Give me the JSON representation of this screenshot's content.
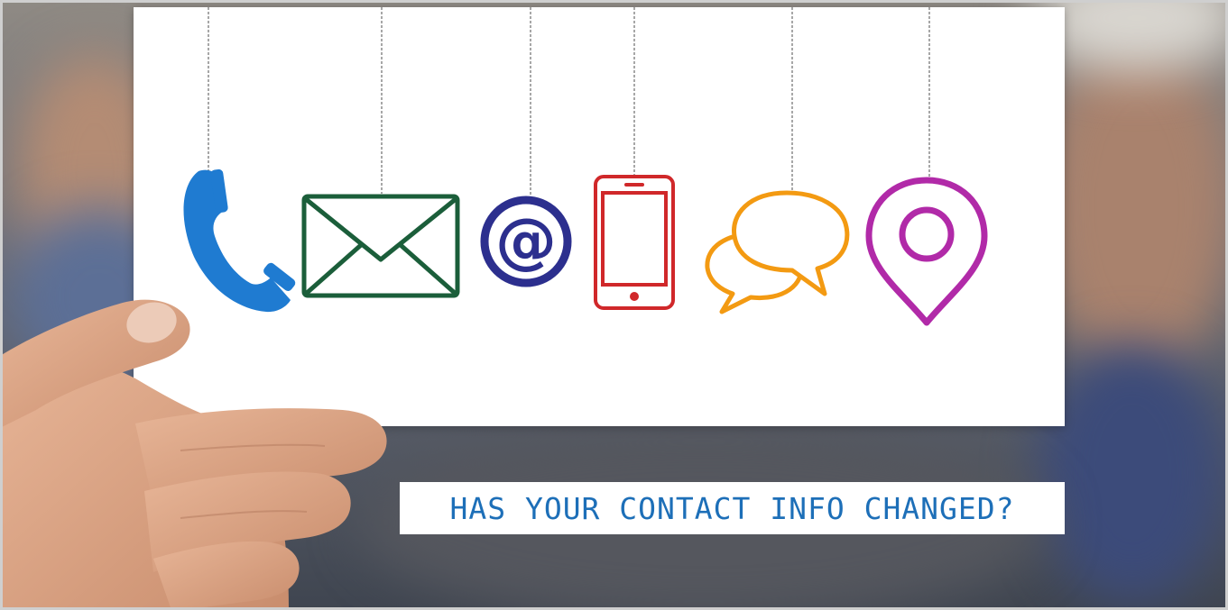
{
  "caption": {
    "text": "HAS YOUR CONTACT INFO CHANGED?",
    "color": "#1d6fb8"
  },
  "icons": [
    {
      "name": "phone-icon",
      "color": "#1f7bd1"
    },
    {
      "name": "envelope-icon",
      "color": "#1b5e3a"
    },
    {
      "name": "at-sign-icon",
      "color": "#2c2f8e"
    },
    {
      "name": "mobile-phone-icon",
      "color": "#d0282a"
    },
    {
      "name": "chat-bubbles-icon",
      "color": "#f39a12"
    },
    {
      "name": "location-pin-icon",
      "color": "#b12aa8"
    }
  ],
  "at_glyph": "@"
}
